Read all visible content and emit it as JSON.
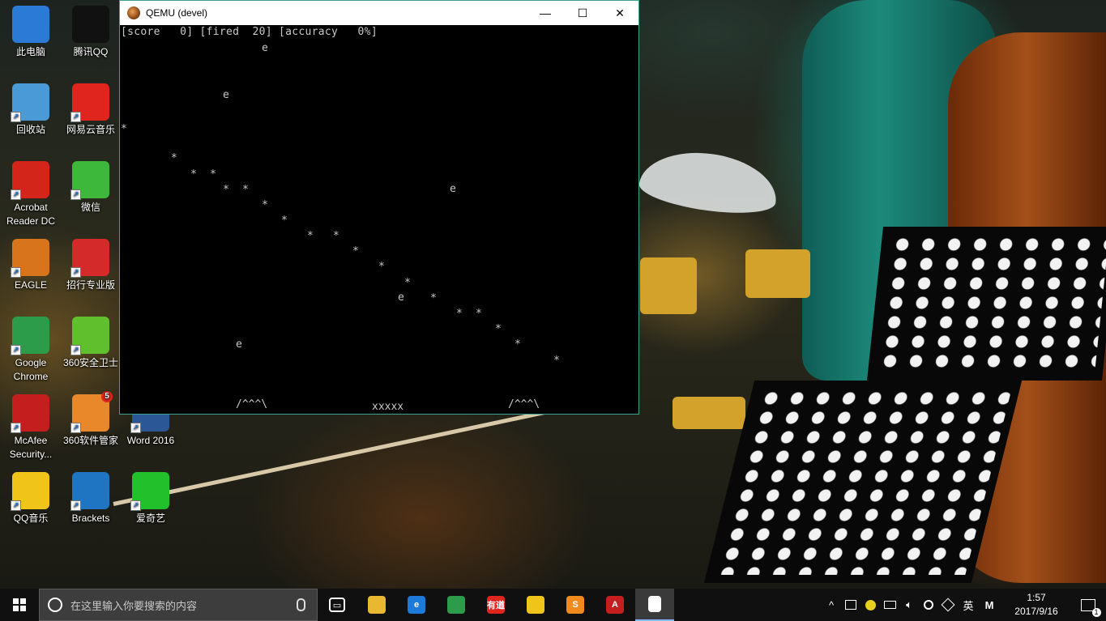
{
  "window": {
    "title": "QEMU (devel)",
    "minimize": "—",
    "maximize": "☐",
    "close": "✕"
  },
  "game": {
    "hud": "[score   0] [fired  20] [accuracy   0%]",
    "enemy_glyph": "e",
    "bullet_glyph": "*",
    "bunker_glyph": "/^^^\\",
    "player_glyph": "xxxxx"
  },
  "desktop_icons": [
    {
      "label": "此电脑",
      "icon": "computer-icon",
      "color": "#2b7bd6"
    },
    {
      "label": "腾讯QQ",
      "icon": "qq-penguin-icon",
      "color": "#111111"
    },
    {
      "label": "回收站",
      "icon": "recycle-bin-icon",
      "color": "#4a9ad8"
    },
    {
      "label": "网易云音乐",
      "icon": "netease-music-icon",
      "color": "#e0251e"
    },
    {
      "label": "Acrobat Reader DC",
      "icon": "acrobat-icon",
      "color": "#d4251b"
    },
    {
      "label": "微信",
      "icon": "wechat-icon",
      "color": "#3db83a"
    },
    {
      "label": "EAGLE",
      "icon": "eagle-icon",
      "color": "#d8741c"
    },
    {
      "label": "招行专业版",
      "icon": "cmb-icon",
      "color": "#d42a2a"
    },
    {
      "label": "Google Chrome",
      "icon": "chrome-icon",
      "color": "#2c9c4a"
    },
    {
      "label": "360安全卫士",
      "icon": "360-safe-icon",
      "color": "#5fbf2c"
    },
    {
      "label": "McAfee Security...",
      "icon": "mcafee-icon",
      "color": "#c41e1e"
    },
    {
      "label": "360软件管家",
      "icon": "360-software-icon",
      "color": "#e8882a",
      "badge": "5"
    },
    {
      "label": "Word 2016",
      "icon": "word-icon",
      "color": "#2b5797"
    },
    {
      "label": "QQ音乐",
      "icon": "qq-music-icon",
      "color": "#f0c419"
    },
    {
      "label": "Brackets",
      "icon": "brackets-icon",
      "color": "#1f75c2"
    },
    {
      "label": "爱奇艺",
      "icon": "iqiyi-icon",
      "color": "#22c02a"
    }
  ],
  "taskbar": {
    "search_placeholder": "在这里输入你要搜索的内容",
    "apps": [
      {
        "name": "task-view-icon",
        "glyph": "▭",
        "color": "#101010"
      },
      {
        "name": "file-explorer-icon",
        "glyph": "",
        "color": "#e8b830"
      },
      {
        "name": "edge-icon",
        "glyph": "e",
        "color": "#1e7ad8"
      },
      {
        "name": "chrome-icon",
        "glyph": "",
        "color": "#2c9c4a"
      },
      {
        "name": "youdao-icon",
        "glyph": "有道",
        "color": "#e0251e"
      },
      {
        "name": "qqbrowser-icon",
        "glyph": "",
        "color": "#f0c419"
      },
      {
        "name": "sublime-icon",
        "glyph": "S",
        "color": "#f08a1c"
      },
      {
        "name": "acrobat-icon",
        "glyph": "A",
        "color": "#c41e1e"
      },
      {
        "name": "qemu-taskbar-icon",
        "glyph": "",
        "color": "#ffffff"
      }
    ],
    "tray": {
      "chevron": "^",
      "ime": "英",
      "ime_mode": "M"
    },
    "clock": {
      "time": "1:57",
      "date": "2017/9/16"
    },
    "notifications": "1"
  }
}
